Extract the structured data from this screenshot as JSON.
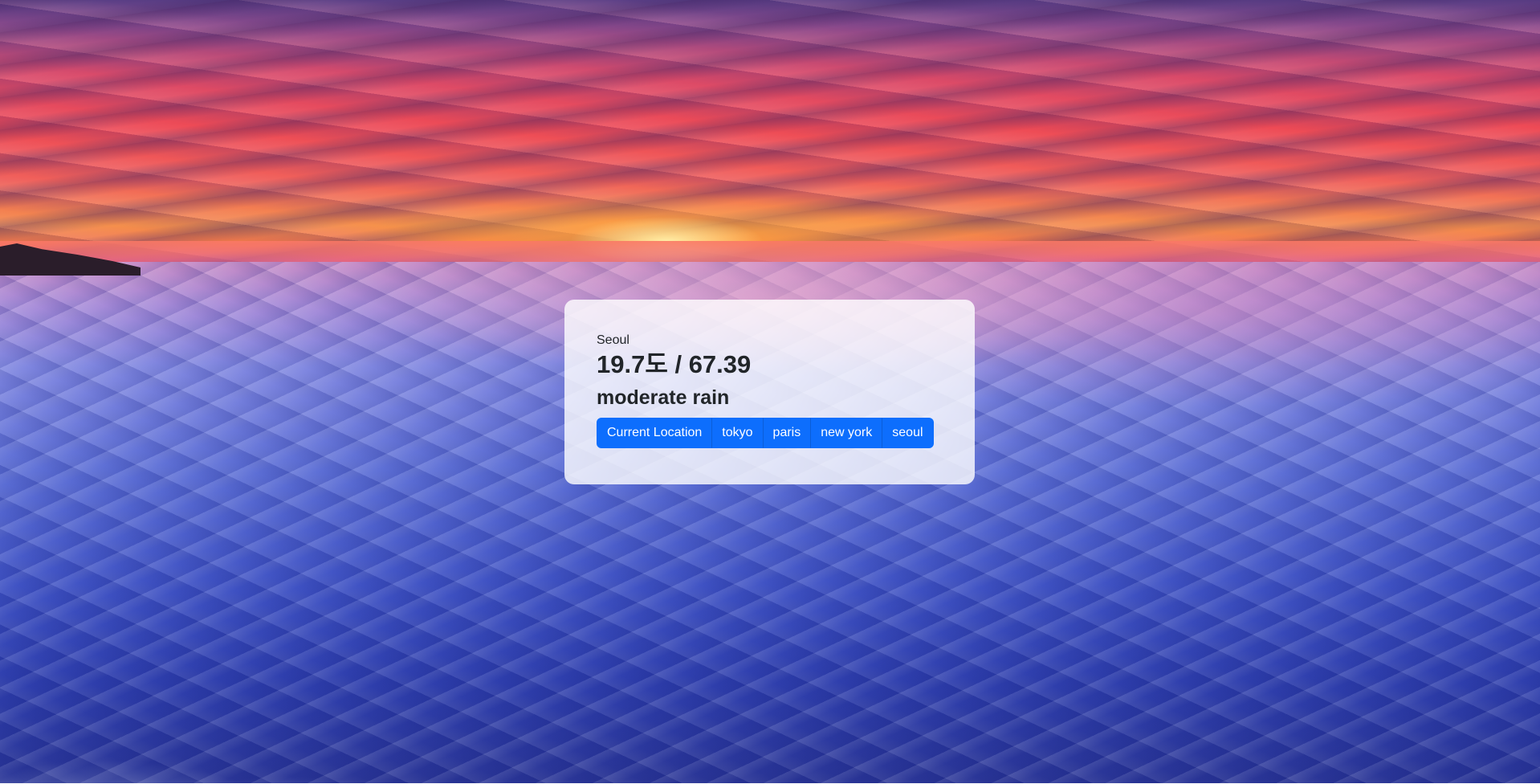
{
  "weather": {
    "city": "Seoul",
    "temperature": "19.7도 / 67.39",
    "description": "moderate rain"
  },
  "buttons": {
    "current_location": "Current Location",
    "cities": [
      "tokyo",
      "paris",
      "new york",
      "seoul"
    ]
  },
  "colors": {
    "button_primary": "#0d6efd",
    "card_background": "rgba(255,255,255,0.80)",
    "text": "#212529"
  }
}
